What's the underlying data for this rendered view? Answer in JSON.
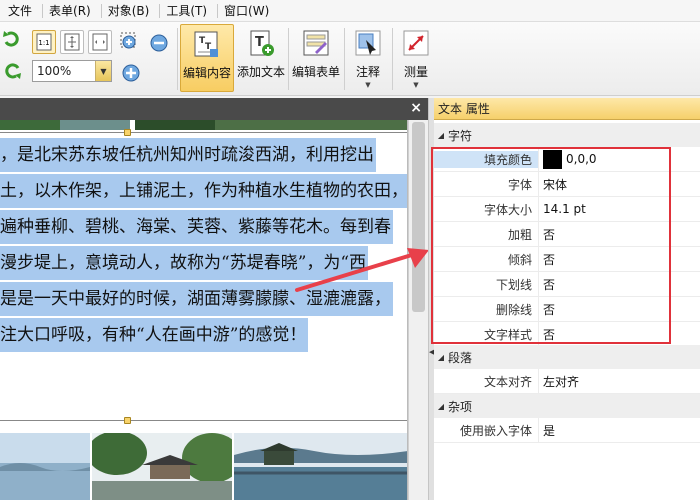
{
  "menu": [
    "文件",
    "表单(R)",
    "对象(B)",
    "工具(T)",
    "窗口(W)"
  ],
  "toolbar": {
    "zoom_value": "100%",
    "buttons": [
      {
        "label": "编辑内容",
        "icon": "edit-content-icon",
        "active": true
      },
      {
        "label": "添加文本",
        "icon": "add-text-icon",
        "active": false
      },
      {
        "label": "编辑表单",
        "icon": "edit-form-icon",
        "active": false
      },
      {
        "label": "注释",
        "icon": "annotate-icon",
        "active": false
      },
      {
        "label": "测量",
        "icon": "measure-icon",
        "active": false
      }
    ]
  },
  "document": {
    "close_label": "×",
    "lines": [
      "，是北宋苏东坡任杭州知州时疏浚西湖，利用挖出",
      "土，以木作架，上铺泥土，作为种植水生植物的农田，",
      "遍种垂柳、碧桃、海棠、芙蓉、紫藤等花木。每到春",
      "漫步堤上，意境动人，故称为“苏堤春晓”，为“西",
      "是是一天中最好的时候，湖面薄雾朦朦、湿漉漉露，",
      "注大口呼吸，有种“人在画中游”的感觉！"
    ]
  },
  "properties": {
    "title": "文本 属性",
    "categories": {
      "char": "字符",
      "para": "段落",
      "misc": "杂项"
    },
    "char_rows": [
      {
        "key": "填充颜色",
        "value": "0,0,0",
        "swatch": "#000000"
      },
      {
        "key": "字体",
        "value": "宋体"
      },
      {
        "key": "字体大小",
        "value": "14.1 pt"
      },
      {
        "key": "加粗",
        "value": "否"
      },
      {
        "key": "倾斜",
        "value": "否"
      },
      {
        "key": "下划线",
        "value": "否"
      },
      {
        "key": "删除线",
        "value": "否"
      },
      {
        "key": "文字样式",
        "value": "否"
      }
    ],
    "para_rows": [
      {
        "key": "文本对齐",
        "value": "左对齐"
      }
    ],
    "misc_rows": [
      {
        "key": "使用嵌入字体",
        "value": "是"
      }
    ]
  },
  "colors": {
    "selection": "#a8c9ee",
    "active_button": "#f7cd62",
    "highlight_box": "#e0313a",
    "arrow": "#e8404a"
  }
}
